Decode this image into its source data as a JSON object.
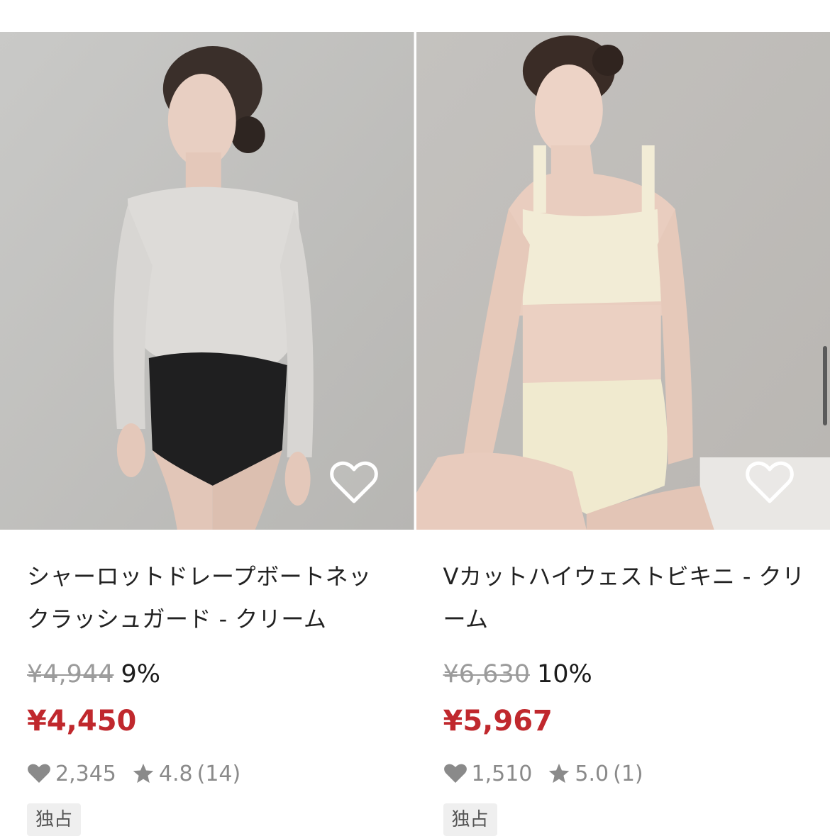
{
  "products": [
    {
      "title": "シャーロットドレープボートネックラッシュガード - クリーム",
      "original_price": "¥4,944",
      "discount": "9%",
      "sale_price": "¥4,450",
      "likes": "2,345",
      "rating": "4.8",
      "reviews": "(14)",
      "badge": "独占"
    },
    {
      "title": "Vカットハイウェストビキニ - クリーム",
      "original_price": "¥6,630",
      "discount": "10%",
      "sale_price": "¥5,967",
      "likes": "1,510",
      "rating": "5.0",
      "reviews": "(1)",
      "badge": "独占"
    }
  ],
  "colors": {
    "sale_price": "#c0282d",
    "original_price": "#9b9b9b",
    "badge_bg": "#efefef"
  },
  "icons": {
    "favorite": "heart-outline-icon",
    "likes": "heart-icon",
    "rating": "star-icon"
  }
}
